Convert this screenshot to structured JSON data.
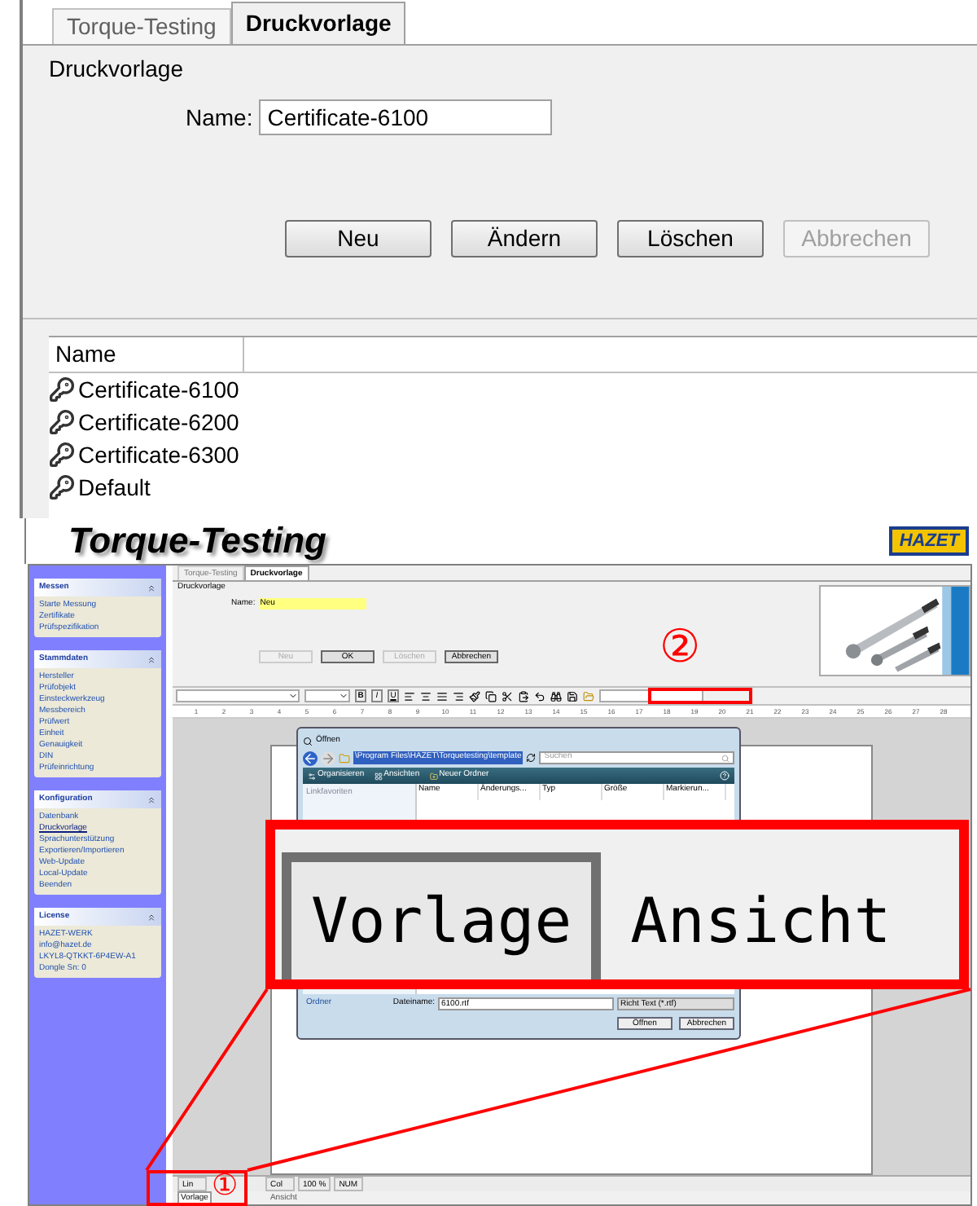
{
  "top_panel": {
    "tabs": [
      {
        "label": "Torque-Testing",
        "selected": false
      },
      {
        "label": "Druckvorlage",
        "selected": true
      }
    ],
    "group_title": "Druckvorlage",
    "name_label": "Name:",
    "name_value": "Certificate-6100",
    "buttons": [
      {
        "label": "Neu",
        "disabled": false
      },
      {
        "label": "Ändern",
        "disabled": false
      },
      {
        "label": "Löschen",
        "disabled": false
      },
      {
        "label": "Abbrechen",
        "disabled": true
      }
    ],
    "list": {
      "column": "Name",
      "rows": [
        "Certificate-6100",
        "Certificate-6200",
        "Certificate-6300",
        "Default"
      ]
    }
  },
  "app": {
    "title": "Torque-Testing",
    "logo": "HAZET",
    "sidebar": [
      {
        "title": "Messen",
        "items": [
          {
            "label": "Starte Messung",
            "selected": false
          },
          {
            "label": "Zertifikate",
            "selected": false
          },
          {
            "label": "Prüfspezifikation",
            "selected": false
          }
        ]
      },
      {
        "title": "Stammdaten",
        "items": [
          {
            "label": "Hersteller",
            "selected": false
          },
          {
            "label": "Prüfobjekt",
            "selected": false
          },
          {
            "label": "Einsteckwerkzeug",
            "selected": false
          },
          {
            "label": "Messbereich",
            "selected": false
          },
          {
            "label": "Prüfwert",
            "selected": false
          },
          {
            "label": "Einheit",
            "selected": false
          },
          {
            "label": "Genauigkeit",
            "selected": false
          },
          {
            "label": "DIN",
            "selected": false
          },
          {
            "label": "Prüfeinrichtung",
            "selected": false
          }
        ]
      },
      {
        "title": "Konfiguration",
        "items": [
          {
            "label": "Datenbank",
            "selected": false
          },
          {
            "label": "Druckvorlage",
            "selected": true
          },
          {
            "label": "Sprachunterstützung",
            "selected": false
          },
          {
            "label": "Exportieren/Importieren",
            "selected": false
          },
          {
            "label": "Web-Update",
            "selected": false
          },
          {
            "label": "Local-Update",
            "selected": false
          },
          {
            "label": "Beenden",
            "selected": false
          }
        ]
      },
      {
        "title": "License",
        "items": [
          {
            "label": "HAZET-WERK",
            "selected": false
          },
          {
            "label": "info@hazet.de",
            "selected": false
          },
          {
            "label": "LKYL8-QTKKT-6P4EW-A1",
            "selected": false
          },
          {
            "label": "Dongle Sn: 0",
            "selected": false
          }
        ]
      }
    ],
    "tabs": [
      {
        "label": "Torque-Testing",
        "selected": false
      },
      {
        "label": "Druckvorlage",
        "selected": true
      }
    ],
    "group_title": "Druckvorlage",
    "name_label": "Name:",
    "name_value": "Neu",
    "buttons": [
      {
        "label": "Neu",
        "disabled": true
      },
      {
        "label": "OK",
        "disabled": false
      },
      {
        "label": "Löschen",
        "disabled": true
      },
      {
        "label": "Abbrechen",
        "disabled": false
      }
    ],
    "format_buttons": [
      "B",
      "I",
      "U"
    ],
    "ruler": [
      "1",
      "2",
      "3",
      "4",
      "5",
      "6",
      "7",
      "8",
      "9",
      "10",
      "11",
      "12",
      "13",
      "14",
      "15",
      "16",
      "17",
      "18",
      "19",
      "20",
      "21",
      "22",
      "23",
      "24",
      "25",
      "26",
      "27",
      "28"
    ],
    "status_bar": [
      "Lin",
      "Col",
      "100 %",
      "NUM"
    ],
    "bottom_tabs": [
      {
        "label": "Vorlage",
        "selected": true
      },
      {
        "label": "Ansicht",
        "selected": false
      }
    ]
  },
  "dialog": {
    "title": "Öffnen",
    "path": "\\Program Files\\HAZET\\Torquetesting\\template",
    "search_placeholder": "Suchen",
    "toolbar": [
      "Organisieren",
      "Ansichten",
      "Neuer Ordner"
    ],
    "nav_title": "Linkfavoriten",
    "columns": [
      "Name",
      "Änderungs...",
      "Typ",
      "Größe",
      "Markierun..."
    ],
    "folder_label": "Ordner",
    "filename_label": "Dateiname:",
    "filename": "6100.rtf",
    "filter": "Richt Text (*.rtf)",
    "buttons": [
      "Öffnen",
      "Abbrechen"
    ]
  },
  "callout": {
    "tabs": [
      {
        "label": "Vorlage",
        "selected": true
      },
      {
        "label": "Ansicht",
        "selected": false
      }
    ]
  },
  "markers": [
    "②",
    "①"
  ]
}
